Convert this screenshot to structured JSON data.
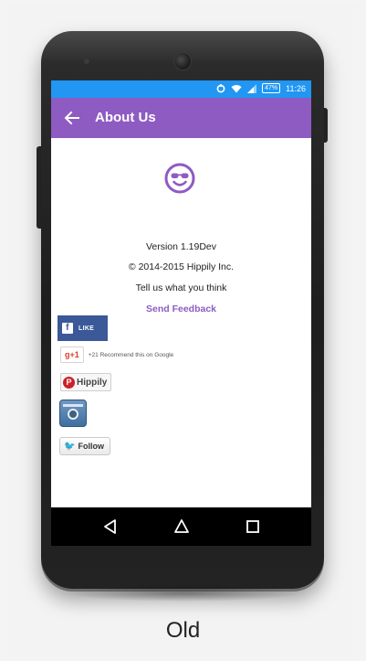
{
  "statusbar": {
    "icons": [
      "sync-icon",
      "wifi-icon",
      "signal-icon",
      "battery-icon"
    ],
    "battery_text": "47%",
    "time": "11:26",
    "color": "#2196f3"
  },
  "appbar": {
    "title": "About Us",
    "color": "#8e5bc2"
  },
  "about": {
    "version": "Version 1.19Dev",
    "copyright": "© 2014-2015 Hippily Inc.",
    "tell": "Tell us what you think",
    "feedback_link": "Send Feedback"
  },
  "social": {
    "facebook_label": "LIKE",
    "gplus_label": "g+1",
    "gplus_text": "+21 Recommend this on Google",
    "pinterest_label": "Hippily",
    "twitter_label": "Follow"
  },
  "caption": "Old"
}
